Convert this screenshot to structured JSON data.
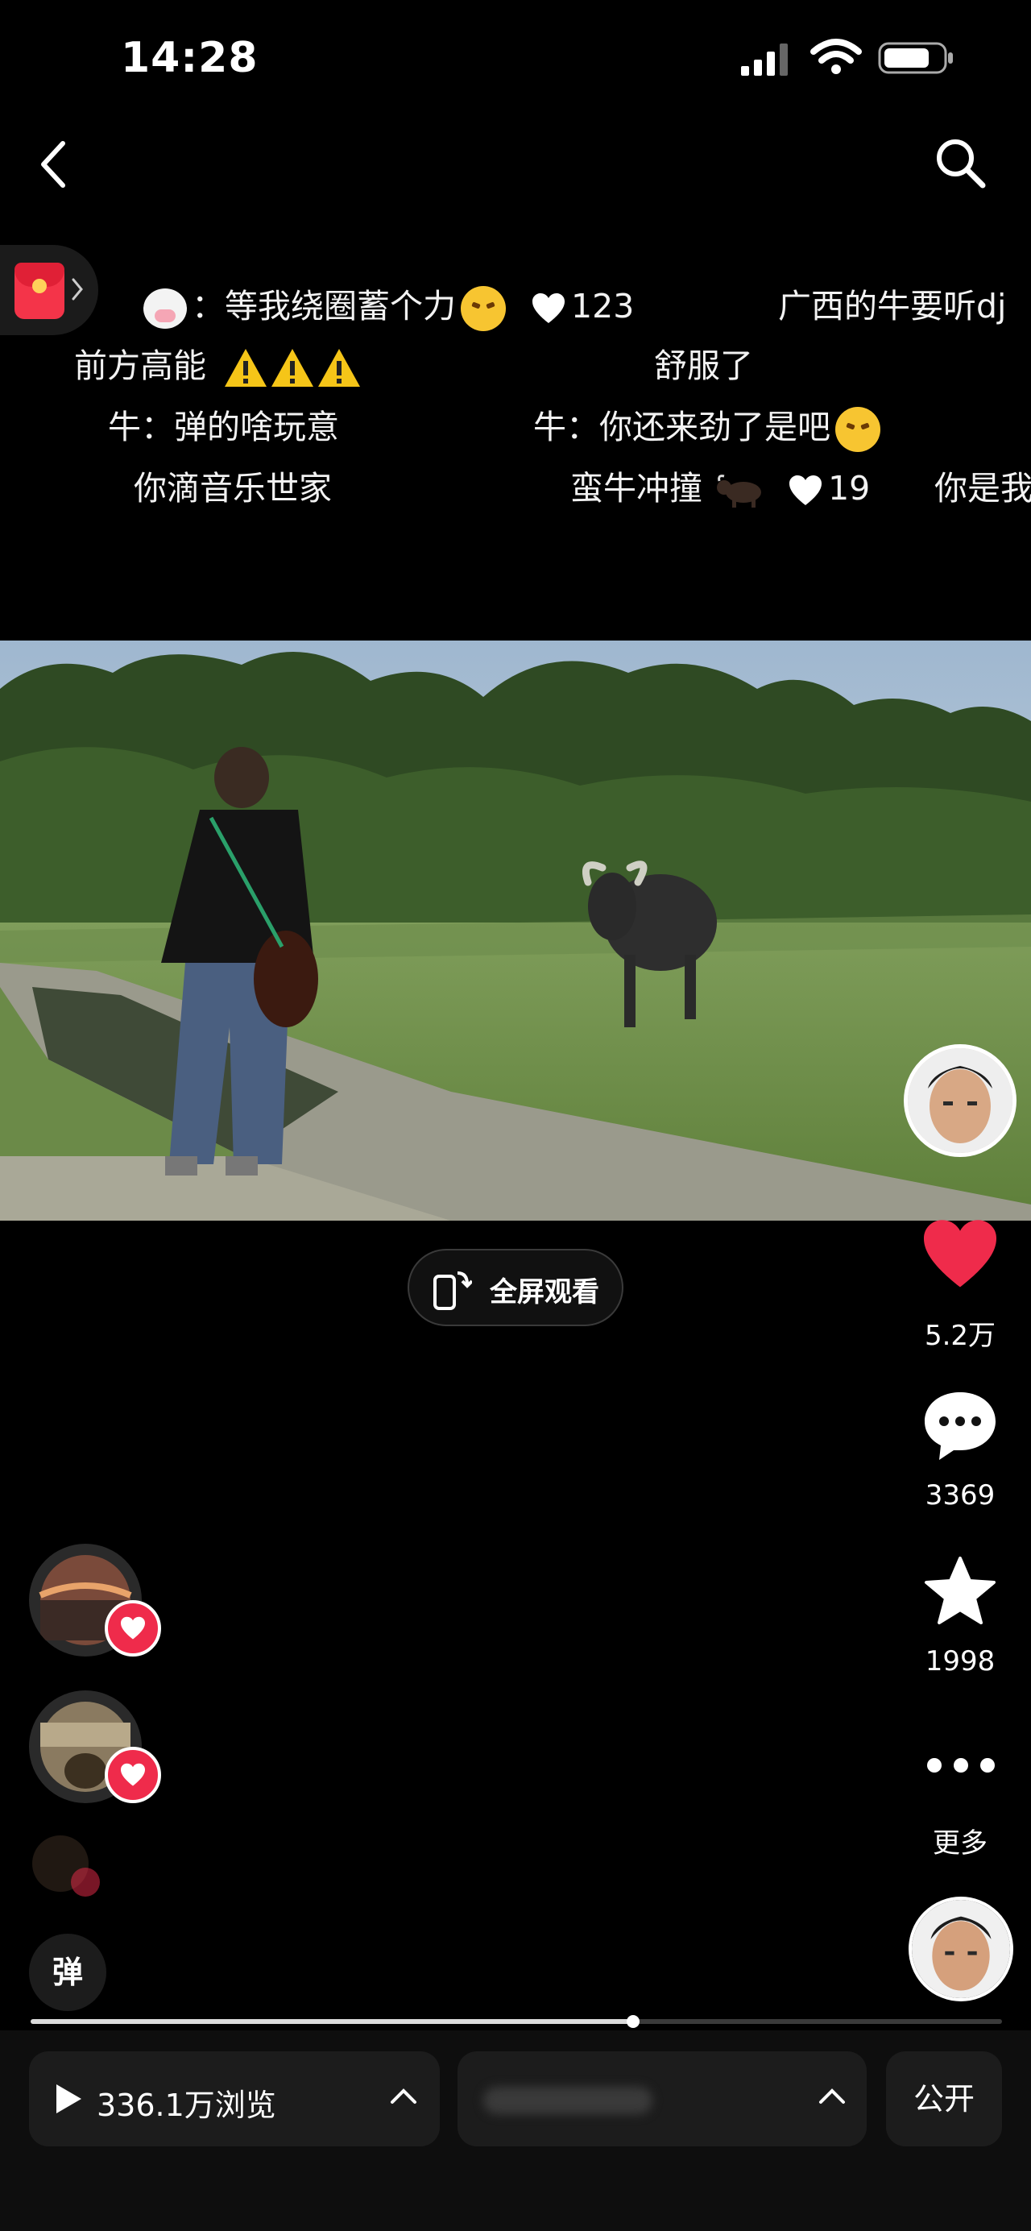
{
  "status_bar": {
    "time": "14:28"
  },
  "danmaku": [
    {
      "text": "：等我绕圈蓄个力",
      "has_cow": true,
      "has_face": true,
      "likes": "123"
    },
    {
      "text": "广西的牛要听dj"
    },
    {
      "text": "前方高能",
      "warnings": 3
    },
    {
      "text": "舒服了"
    },
    {
      "text": "牛：弹的啥玩意"
    },
    {
      "text": "牛：你还来劲了是吧",
      "has_face": true
    },
    {
      "text": "你滴音乐世家"
    },
    {
      "text": "蛮牛冲撞",
      "likes": "19"
    },
    {
      "text": "你是我"
    }
  ],
  "fullscreen_button": {
    "label": "全屏观看"
  },
  "actions": {
    "like_count": "5.2万",
    "comment_count": "3369",
    "favorite_count": "1998",
    "more_label": "更多"
  },
  "danmu_toggle": {
    "label": "弹"
  },
  "progress": {
    "fraction": 0.62
  },
  "bottom": {
    "views": "336.1万浏览",
    "public_label": "公开"
  },
  "colors": {
    "like_red": "#ef2b4b",
    "background": "#000000",
    "pill_bg": "#1c1c1c"
  }
}
